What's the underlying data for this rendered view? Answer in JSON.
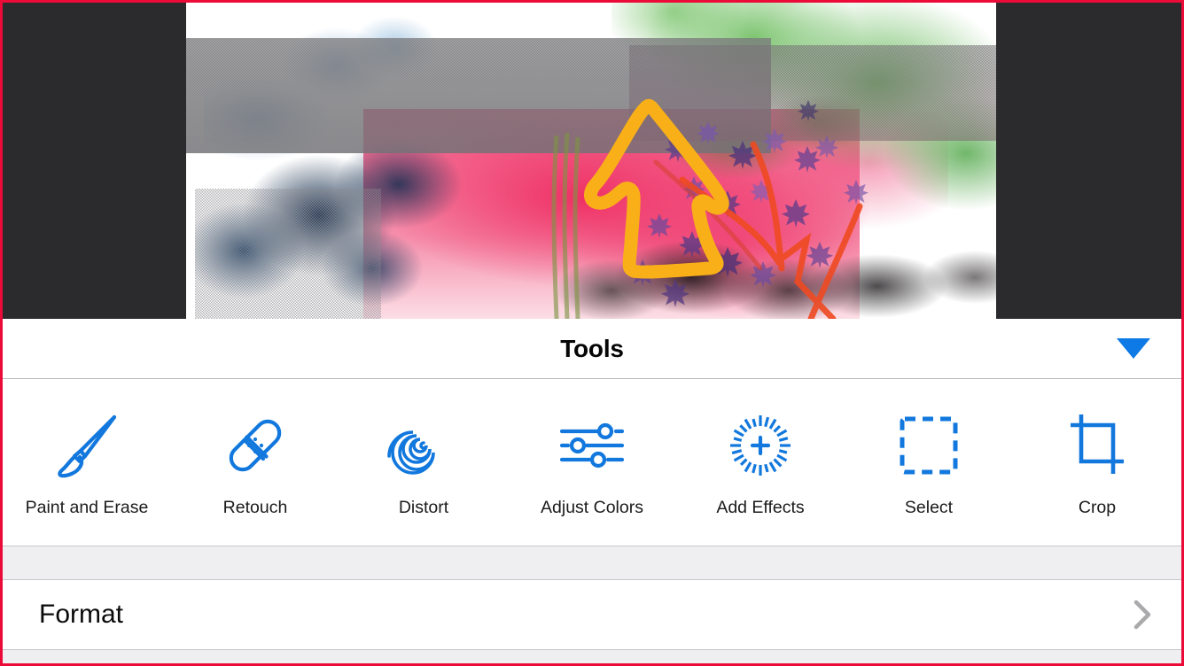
{
  "panel": {
    "title": "Tools",
    "collapse_icon": "triangle-down-icon",
    "accent_blue": "#0d7ae6",
    "icon_blue": "#1278dd",
    "border_red": "#ec0b38"
  },
  "tools": [
    {
      "label": "Paint and Erase",
      "icon": "paintbrush-icon"
    },
    {
      "label": "Retouch",
      "icon": "bandage-icon"
    },
    {
      "label": "Distort",
      "icon": "spiral-icon"
    },
    {
      "label": "Adjust Colors",
      "icon": "sliders-icon"
    },
    {
      "label": "Add Effects",
      "icon": "starburst-plus-icon"
    },
    {
      "label": "Select",
      "icon": "dashed-square-icon"
    },
    {
      "label": "Crop",
      "icon": "crop-marks-icon"
    }
  ],
  "format_row": {
    "label": "Format",
    "chevron_icon": "chevron-right-icon"
  },
  "canvas": {
    "letterbox_color": "#2b2b2d",
    "artwork_description": "Abstract digital painting: grainy gray band, blue and navy clouds, pink and crimson washes, green watercolor foliage, purple scattered leaves, thick orange lasso outline and red-orange strokes"
  }
}
